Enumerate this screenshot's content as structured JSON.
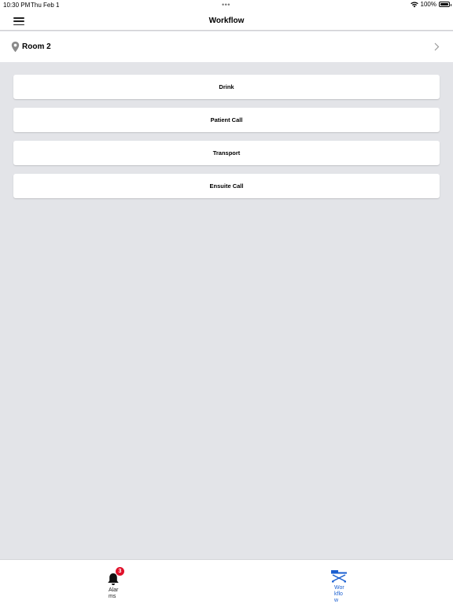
{
  "status_bar": {
    "time": "10:30 PM",
    "date": "Thu Feb 1",
    "dots": "•••",
    "battery": "100%"
  },
  "nav": {
    "title": "Workflow",
    "menu_icon": "hamburger-menu-icon"
  },
  "room": {
    "label": "Room 2",
    "icon": "location-pin-icon"
  },
  "workflow_items": [
    {
      "label": "Drink"
    },
    {
      "label": "Patient Call"
    },
    {
      "label": "Transport"
    },
    {
      "label": "Ensuite Call"
    }
  ],
  "tab_bar": {
    "tabs": [
      {
        "label": "Alarms",
        "icon": "bell-icon",
        "badge": "3",
        "active": false
      },
      {
        "label": "Workflow",
        "icon": "hospital-bed-icon",
        "active": true
      }
    ]
  },
  "colors": {
    "background": "#e3e4e8",
    "accent": "#1a5fd0",
    "badge": "#e0102a"
  }
}
